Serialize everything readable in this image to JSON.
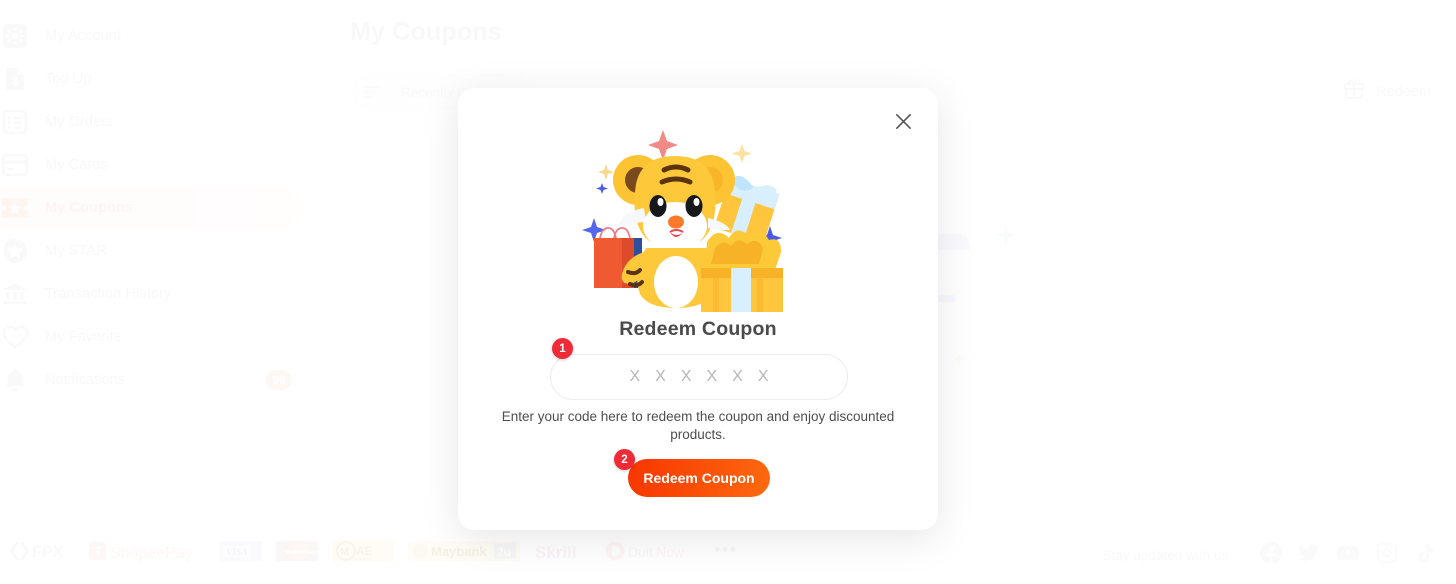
{
  "sidebar": {
    "items": [
      {
        "label": "My Account",
        "icon": "gear-icon",
        "active": false,
        "badge": null
      },
      {
        "label": "Top Up",
        "icon": "topup-icon",
        "active": false,
        "badge": null
      },
      {
        "label": "My Orders",
        "icon": "list-icon",
        "active": false,
        "badge": null
      },
      {
        "label": "My Cards",
        "icon": "card-icon",
        "active": false,
        "badge": null
      },
      {
        "label": "My Coupons",
        "icon": "ticket-icon",
        "active": true,
        "badge": null
      },
      {
        "label": "My STAR",
        "icon": "star-icon",
        "active": false,
        "badge": null
      },
      {
        "label": "Transaction History",
        "icon": "bank-icon",
        "active": false,
        "badge": null
      },
      {
        "label": "My Favorite",
        "icon": "heart-icon",
        "active": false,
        "badge": null
      },
      {
        "label": "Notifications",
        "icon": "bell-icon",
        "active": false,
        "badge": "99"
      }
    ]
  },
  "main": {
    "title": "My Coupons",
    "sort": {
      "icon": "sort-icon",
      "value": "Recently Claimed"
    },
    "redeem_action": {
      "icon": "gift-icon",
      "label": "Redeem"
    }
  },
  "modal": {
    "close_icon": "close-icon",
    "hero_icon": "tiger-gift-illustration",
    "title": "Redeem Coupon",
    "code_placeholder_chars": [
      "X",
      "X",
      "X",
      "X",
      "X",
      "X"
    ],
    "helper_text": "Enter your code here to redeem the coupon and enjoy discounted products.",
    "cta_label": "Redeem Coupon",
    "step_badges": [
      "1",
      "2"
    ]
  },
  "footer": {
    "payment_methods": [
      "FPX",
      "ShopeePay",
      "VISA",
      "MasterCard",
      "MAE",
      "Maybank2u",
      "Skrill",
      "DuitNow"
    ],
    "more_label": "•••",
    "social_label": "Stay updated with us",
    "social_icons": [
      "facebook-icon",
      "twitter-icon",
      "youtube-icon",
      "instagram-icon",
      "tiktok-icon"
    ]
  },
  "colors": {
    "accent_orange": "#f83600",
    "accent_salmon": "#f7c7b6",
    "badge_red": "#ef2b38",
    "muted_text": "#dcdcdc"
  }
}
